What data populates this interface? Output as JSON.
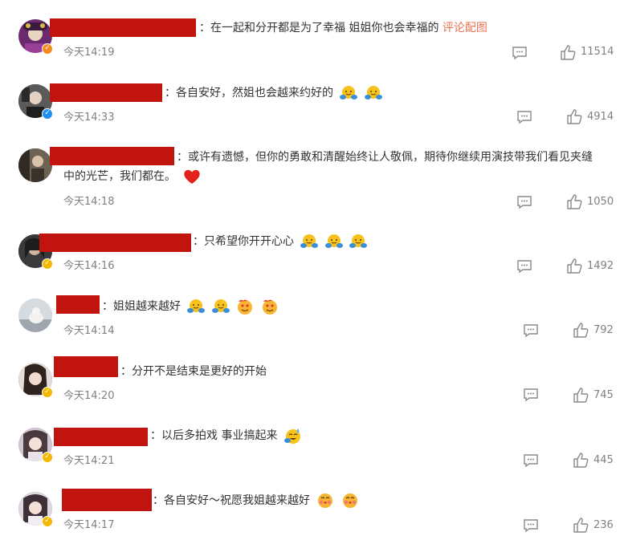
{
  "comments": [
    {
      "text": "：在一起和分开都是为了幸福 姐姐你也会幸福的 ",
      "link": "评论配图",
      "time": "今天14:19",
      "likes": "11514",
      "badge": "orange",
      "avatar_color": "#6b2a6e"
    },
    {
      "text": "：各自安好，然姐也会越来约好的",
      "time": "今天14:33",
      "likes": "4914",
      "badge": "blue",
      "avatar_color": "#3a3a3a"
    },
    {
      "text_line1": "：或许有遗憾，但你的勇敢和清醒始终让人敬佩，期待你继续用演技带我们看见夹缝",
      "text_line2": "中的光芒，我们都在。",
      "time": "今天14:18",
      "likes": "1050",
      "badge": "none",
      "avatar_color": "#4a4036"
    },
    {
      "text": "：只希望你开开心心",
      "time": "今天14:16",
      "likes": "1492",
      "badge": "gold",
      "avatar_color": "#2b2b2b"
    },
    {
      "text": "：姐姐越来越好",
      "time": "今天14:14",
      "likes": "792",
      "badge": "none",
      "avatar_color": "#c9cfd4"
    },
    {
      "text": "：分开不是结束是更好的开始",
      "time": "今天14:20",
      "likes": "745",
      "badge": "gold",
      "avatar_color": "#7a6a62"
    },
    {
      "text": "：以后多拍戏 事业搞起来",
      "time": "今天14:21",
      "likes": "445",
      "badge": "gold",
      "avatar_color": "#b7a9b6"
    },
    {
      "text": "：各自安好～祝愿我姐越来越好",
      "time": "今天14:17",
      "likes": "236",
      "badge": "gold",
      "avatar_color": "#8d8a93"
    }
  ],
  "icons": {
    "reply": "comment-icon",
    "like": "thumbs-up-icon"
  },
  "colors": {
    "redaction": "#c1140f",
    "link": "#eb7350",
    "meta": "#808080"
  }
}
